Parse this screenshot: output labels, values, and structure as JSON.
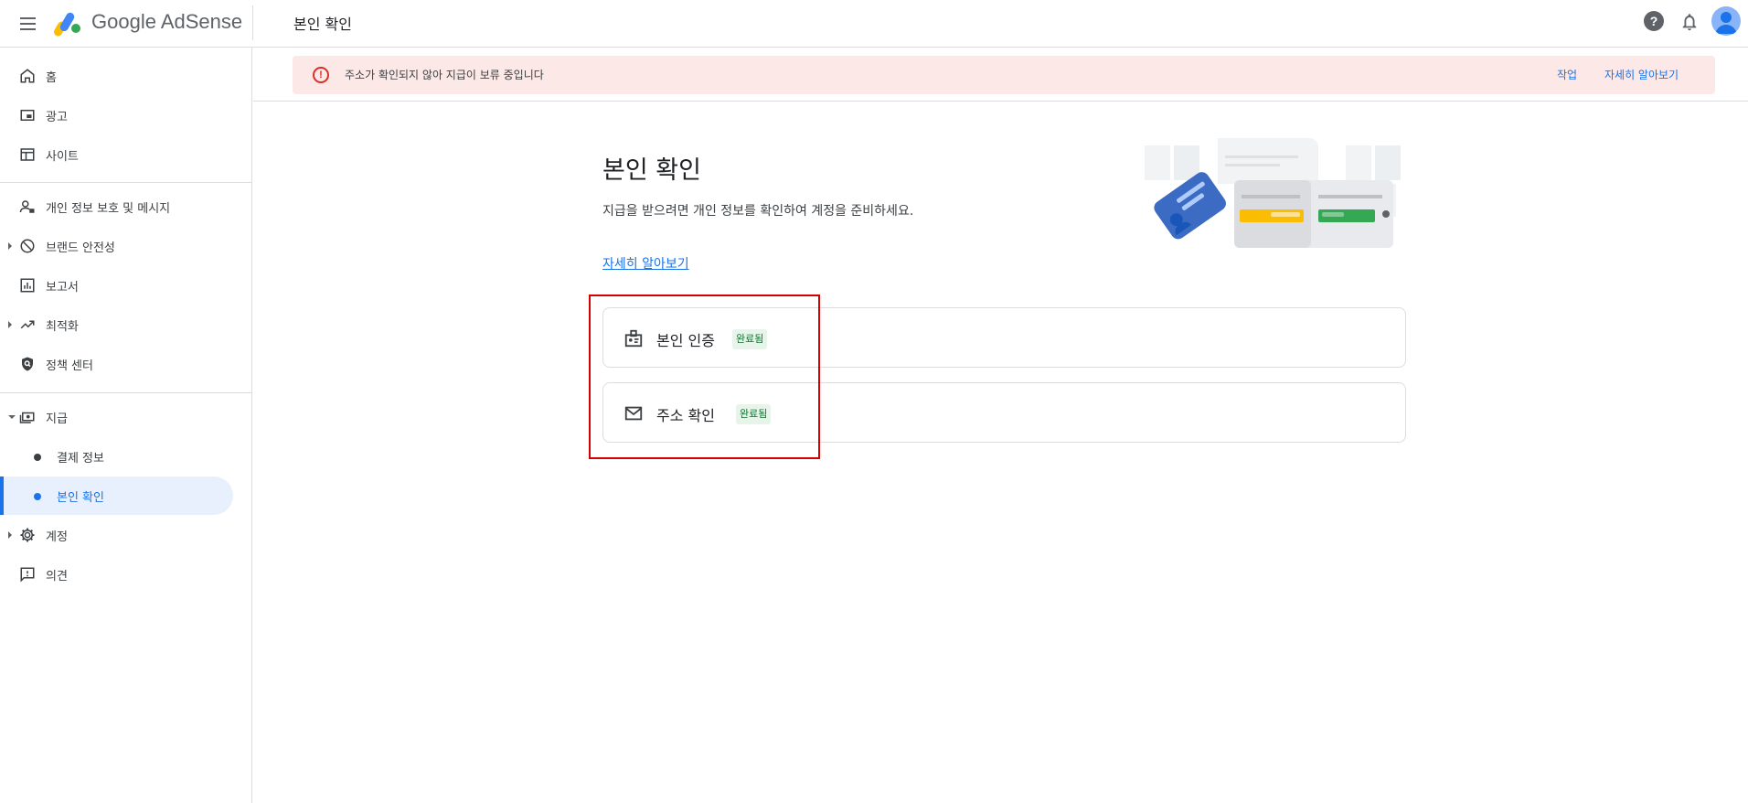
{
  "app": {
    "brand": "Google AdSense",
    "page_title": "본인 확인"
  },
  "header": {
    "help_label": "?"
  },
  "sidebar": {
    "items": [
      {
        "label": "홈",
        "icon": "home-icon"
      },
      {
        "label": "광고",
        "icon": "ads-icon"
      },
      {
        "label": "사이트",
        "icon": "sites-icon"
      },
      {
        "label": "개인 정보 보호 및 메시지",
        "icon": "privacy-icon"
      },
      {
        "label": "브랜드 안전성",
        "icon": "block-icon"
      },
      {
        "label": "보고서",
        "icon": "reports-icon"
      },
      {
        "label": "최적화",
        "icon": "trending-icon"
      },
      {
        "label": "정책 센터",
        "icon": "policy-shield-icon"
      },
      {
        "label": "지급",
        "icon": "payments-icon"
      },
      {
        "label": "결제 정보"
      },
      {
        "label": "본인 확인"
      },
      {
        "label": "계정",
        "icon": "gear-icon"
      },
      {
        "label": "의견",
        "icon": "feedback-icon"
      }
    ]
  },
  "alert": {
    "icon_label": "!",
    "message": "주소가 확인되지 않아 지급이 보류 중입니다",
    "action": "작업",
    "learn_more": "자세히 알아보기"
  },
  "main": {
    "title": "본인 확인",
    "description": "지급을 받으려면 개인 정보를 확인하여 계정을 준비하세요.",
    "learn_more": "자세히 알아보기",
    "cards": [
      {
        "title": "본인 인증",
        "status": "완료됨",
        "icon": "id-badge-icon"
      },
      {
        "title": "주소 확인",
        "status": "완료됨",
        "icon": "mail-icon"
      }
    ]
  },
  "colors": {
    "accent": "#1a73e8",
    "alert_bg": "#fce8e6",
    "error": "#d93025",
    "success_bg": "#e6f4ea",
    "success_text": "#137333",
    "highlight": "#d50000"
  }
}
